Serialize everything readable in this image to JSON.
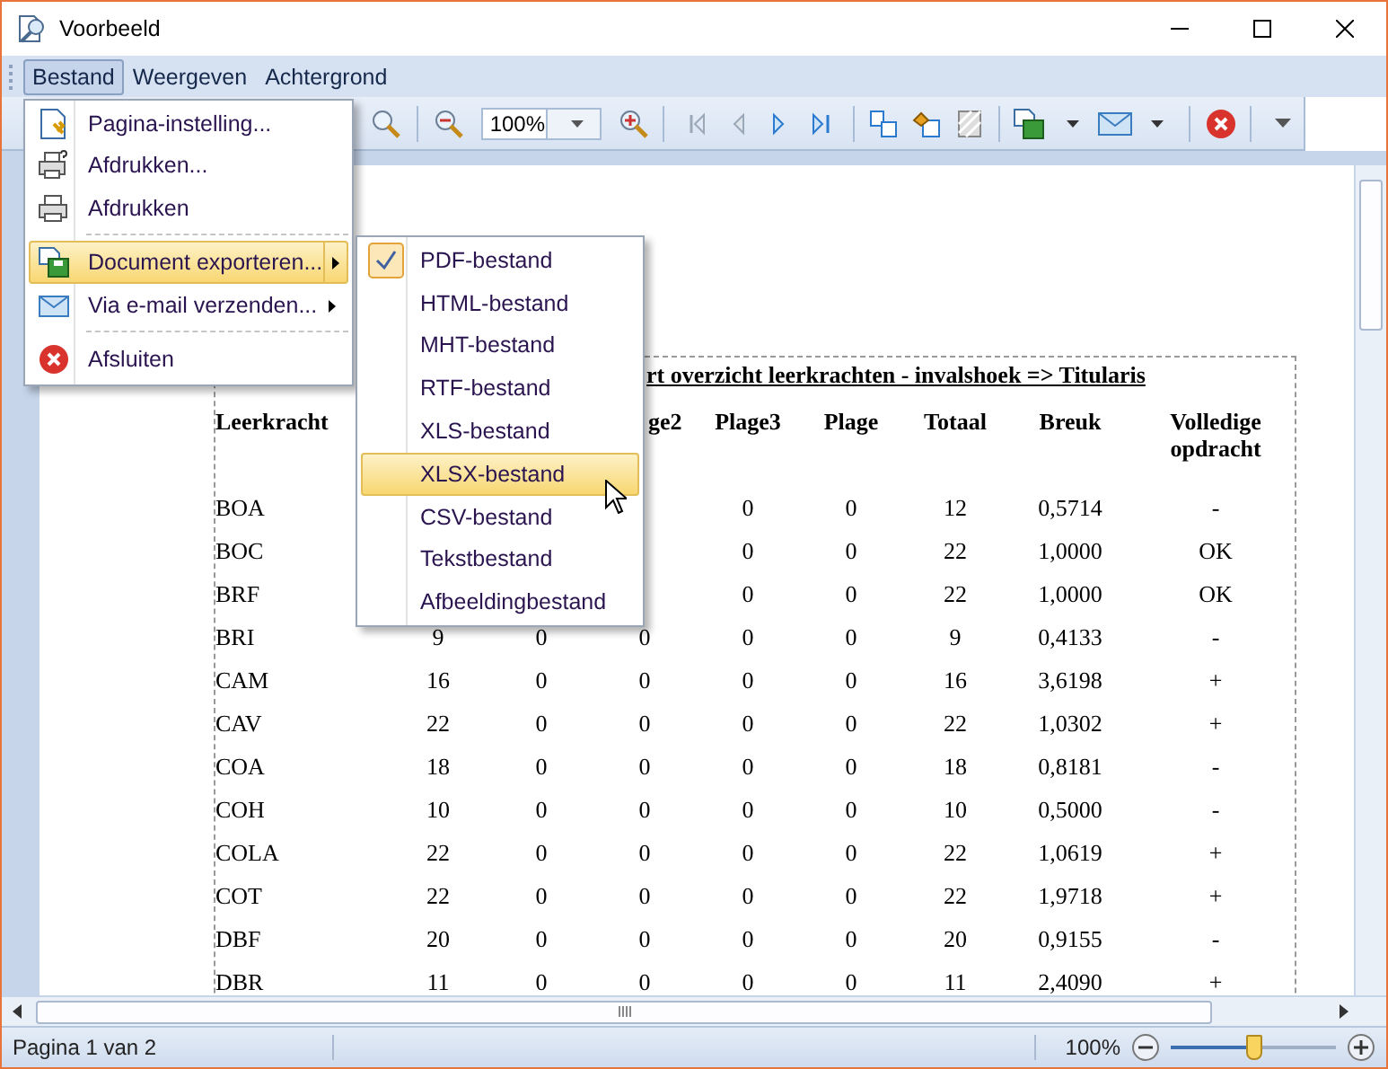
{
  "window": {
    "title": "Voorbeeld"
  },
  "menubar": [
    {
      "label": "Bestand",
      "selected": true
    },
    {
      "label": "Weergeven",
      "selected": false
    },
    {
      "label": "Achtergrond",
      "selected": false
    }
  ],
  "toolbar": {
    "zoom_value": "100%"
  },
  "file_menu": [
    {
      "kind": "item",
      "label": "Pagina-instelling...",
      "submenu": false,
      "selected": false
    },
    {
      "kind": "item",
      "label": "Afdrukken...",
      "submenu": false,
      "selected": false
    },
    {
      "kind": "item",
      "label": "Afdrukken",
      "submenu": false,
      "selected": false
    },
    {
      "kind": "separator"
    },
    {
      "kind": "item",
      "label": "Document exporteren...",
      "submenu": true,
      "selected": true
    },
    {
      "kind": "item",
      "label": "Via e-mail verzenden...",
      "submenu": true,
      "selected": false
    },
    {
      "kind": "separator"
    },
    {
      "kind": "item",
      "label": "Afsluiten",
      "submenu": false,
      "selected": false
    }
  ],
  "export_submenu": [
    {
      "label": "PDF-bestand",
      "checked": true,
      "selected": false
    },
    {
      "label": "HTML-bestand",
      "checked": false,
      "selected": false
    },
    {
      "label": "MHT-bestand",
      "checked": false,
      "selected": false
    },
    {
      "label": "RTF-bestand",
      "checked": false,
      "selected": false
    },
    {
      "label": "XLS-bestand",
      "checked": false,
      "selected": false
    },
    {
      "label": "XLSX-bestand",
      "checked": false,
      "selected": true
    },
    {
      "label": "CSV-bestand",
      "checked": false,
      "selected": false
    },
    {
      "label": "Tekstbestand",
      "checked": false,
      "selected": false
    },
    {
      "label": "Afbeeldingbestand",
      "checked": false,
      "selected": false
    }
  ],
  "report": {
    "title": "rt overzicht leerkrachten - invalshoek => Titularis",
    "columns": [
      "Leerkracht",
      null,
      null,
      "ge2",
      "Plage3",
      "Plage",
      "Totaal",
      "Breuk",
      "Volledige opdracht"
    ],
    "rows": [
      [
        "BOA",
        null,
        null,
        null,
        "0",
        "0",
        "12",
        "0,5714",
        "-"
      ],
      [
        "BOC",
        null,
        null,
        null,
        "0",
        "0",
        "22",
        "1,0000",
        "OK"
      ],
      [
        "BRF",
        null,
        null,
        null,
        "0",
        "0",
        "22",
        "1,0000",
        "OK"
      ],
      [
        "BRI",
        "9",
        "0",
        "0",
        "0",
        "0",
        "9",
        "0,4133",
        "-"
      ],
      [
        "CAM",
        "16",
        "0",
        "0",
        "0",
        "0",
        "16",
        "3,6198",
        "+"
      ],
      [
        "CAV",
        "22",
        "0",
        "0",
        "0",
        "0",
        "22",
        "1,0302",
        "+"
      ],
      [
        "COA",
        "18",
        "0",
        "0",
        "0",
        "0",
        "18",
        "0,8181",
        "-"
      ],
      [
        "COH",
        "10",
        "0",
        "0",
        "0",
        "0",
        "10",
        "0,5000",
        "-"
      ],
      [
        "COLA",
        "22",
        "0",
        "0",
        "0",
        "0",
        "22",
        "1,0619",
        "+"
      ],
      [
        "COT",
        "22",
        "0",
        "0",
        "0",
        "0",
        "22",
        "1,9718",
        "+"
      ],
      [
        "DBF",
        "20",
        "0",
        "0",
        "0",
        "0",
        "20",
        "0,9155",
        "-"
      ],
      [
        "DBR",
        "11",
        "0",
        "0",
        "0",
        "0",
        "11",
        "2,4090",
        "+"
      ]
    ]
  },
  "status_bar": {
    "page": "Pagina 1 van 2",
    "zoom": "100%",
    "zoom_slider": {
      "level": 0.5
    }
  }
}
